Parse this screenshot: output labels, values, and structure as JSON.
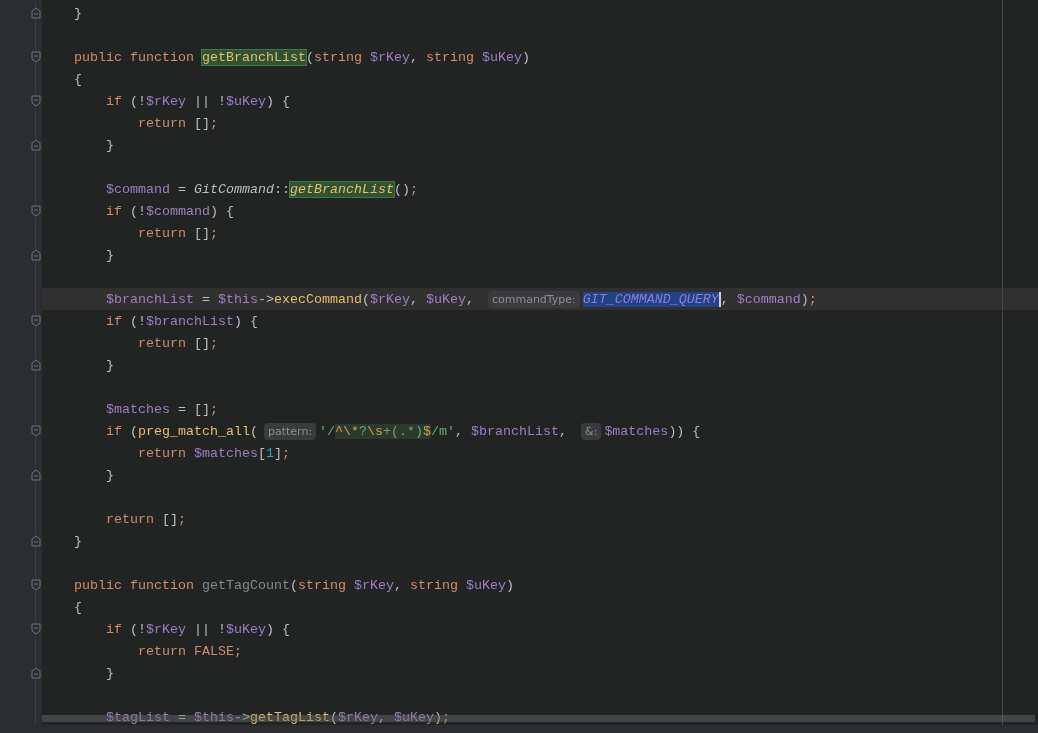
{
  "editor": {
    "lines": [
      {
        "current": false,
        "gutter_mark": {
          "kind": "fold-end"
        },
        "tokens": [
          {
            "text": "    }",
            "kind": "plain"
          }
        ]
      },
      {
        "current": false
      },
      {
        "current": false,
        "gutter_mark": {
          "kind": "fold-start"
        },
        "tokens": [
          {
            "text": "    public function ",
            "kind": "kw"
          },
          {
            "text": "getBranchList",
            "kind": "fn-match"
          },
          {
            "text": "(",
            "kind": "plain"
          },
          {
            "text": "string ",
            "kind": "kw"
          },
          {
            "text": "$rKey",
            "kind": "var"
          },
          {
            "text": ", ",
            "kind": "plain"
          },
          {
            "text": "string ",
            "kind": "kw"
          },
          {
            "text": "$uKey",
            "kind": "var"
          },
          {
            "text": ")",
            "kind": "plain"
          }
        ]
      },
      {
        "current": false,
        "tokens": [
          {
            "text": "    {",
            "kind": "plain"
          }
        ]
      },
      {
        "current": false,
        "gutter_mark": {
          "kind": "fold-start"
        },
        "tokens": [
          {
            "text": "        if ",
            "kind": "kw"
          },
          {
            "text": "(!",
            "kind": "plain"
          },
          {
            "text": "$rKey",
            "kind": "var"
          },
          {
            "text": " || !",
            "kind": "plain"
          },
          {
            "text": "$uKey",
            "kind": "var"
          },
          {
            "text": ") {",
            "kind": "plain"
          }
        ]
      },
      {
        "current": false,
        "tokens": [
          {
            "text": "            return ",
            "kind": "kw"
          },
          {
            "text": "[]",
            "kind": "plain"
          },
          {
            "text": ";",
            "kind": "kw"
          }
        ]
      },
      {
        "current": false,
        "gutter_mark": {
          "kind": "fold-end"
        },
        "tokens": [
          {
            "text": "        }",
            "kind": "plain"
          }
        ]
      },
      {
        "current": false
      },
      {
        "current": false,
        "tokens": [
          {
            "text": "        $command",
            "kind": "var"
          },
          {
            "text": " = ",
            "kind": "plain"
          },
          {
            "text": "GitCommand",
            "kind": "cls"
          },
          {
            "text": "::",
            "kind": "plain"
          },
          {
            "text": "getBranchList",
            "kind": "static-match"
          },
          {
            "text": "()",
            "kind": "plain"
          },
          {
            "text": ";",
            "kind": "kw"
          }
        ]
      },
      {
        "current": false,
        "gutter_mark": {
          "kind": "fold-start"
        },
        "tokens": [
          {
            "text": "        if ",
            "kind": "kw"
          },
          {
            "text": "(!",
            "kind": "plain"
          },
          {
            "text": "$command",
            "kind": "var"
          },
          {
            "text": ") {",
            "kind": "plain"
          }
        ]
      },
      {
        "current": false,
        "tokens": [
          {
            "text": "            return ",
            "kind": "kw"
          },
          {
            "text": "[]",
            "kind": "plain"
          },
          {
            "text": ";",
            "kind": "kw"
          }
        ]
      },
      {
        "current": false,
        "gutter_mark": {
          "kind": "fold-end"
        },
        "tokens": [
          {
            "text": "        }",
            "kind": "plain"
          }
        ]
      },
      {
        "current": false
      },
      {
        "current": true,
        "tokens": [
          {
            "text": "        $branchList",
            "kind": "var"
          },
          {
            "text": " = ",
            "kind": "plain"
          },
          {
            "text": "$this",
            "kind": "var"
          },
          {
            "text": "->",
            "kind": "plain"
          },
          {
            "text": "execCommand",
            "kind": "fn"
          },
          {
            "text": "(",
            "kind": "plain"
          },
          {
            "text": "$rKey",
            "kind": "var"
          },
          {
            "text": ", ",
            "kind": "plain"
          },
          {
            "text": "$uKey",
            "kind": "var"
          },
          {
            "text": ", ",
            "kind": "plain"
          },
          {
            "text": "commandType:",
            "kind": "hint"
          },
          {
            "text": "GIT_COMMAND_QUERY",
            "kind": "selection",
            "caret": true
          },
          {
            "text": ", ",
            "kind": "plain"
          },
          {
            "text": "$command",
            "kind": "var"
          },
          {
            "text": ")",
            "kind": "plain"
          },
          {
            "text": ";",
            "kind": "kw"
          }
        ]
      },
      {
        "current": false,
        "gutter_mark": {
          "kind": "fold-start"
        },
        "tokens": [
          {
            "text": "        if ",
            "kind": "kw"
          },
          {
            "text": "(!",
            "kind": "plain"
          },
          {
            "text": "$branchList",
            "kind": "var"
          },
          {
            "text": ") {",
            "kind": "plain"
          }
        ]
      },
      {
        "current": false,
        "tokens": [
          {
            "text": "            return ",
            "kind": "kw"
          },
          {
            "text": "[]",
            "kind": "plain"
          },
          {
            "text": ";",
            "kind": "kw"
          }
        ]
      },
      {
        "current": false,
        "gutter_mark": {
          "kind": "fold-end"
        },
        "tokens": [
          {
            "text": "        }",
            "kind": "plain"
          }
        ]
      },
      {
        "current": false
      },
      {
        "current": false,
        "tokens": [
          {
            "text": "        $matches",
            "kind": "var"
          },
          {
            "text": " = []",
            "kind": "plain"
          },
          {
            "text": ";",
            "kind": "kw"
          }
        ]
      },
      {
        "current": false,
        "gutter_mark": {
          "kind": "fold-start"
        },
        "tokens": [
          {
            "text": "        if ",
            "kind": "kw"
          },
          {
            "text": "(",
            "kind": "plain"
          },
          {
            "text": "preg_match_all",
            "kind": "fn"
          },
          {
            "text": "(",
            "kind": "plain"
          },
          {
            "text": "pattern:",
            "kind": "hint"
          },
          {
            "text": "'/",
            "kind": "str"
          },
          {
            "text": "^\\*",
            "kind": "regex-esc"
          },
          {
            "text": "?",
            "kind": "regex"
          },
          {
            "text": "\\s",
            "kind": "regex-esc"
          },
          {
            "text": "+(.*)",
            "kind": "regex"
          },
          {
            "text": "$",
            "kind": "regex-esc"
          },
          {
            "text": "/m'",
            "kind": "str"
          },
          {
            "text": ", ",
            "kind": "plain"
          },
          {
            "text": "$branchList",
            "kind": "var"
          },
          {
            "text": ", ",
            "kind": "plain"
          },
          {
            "text": "&:",
            "kind": "hint"
          },
          {
            "text": "$matches",
            "kind": "var"
          },
          {
            "text": ")) {",
            "kind": "plain"
          }
        ]
      },
      {
        "current": false,
        "tokens": [
          {
            "text": "            return ",
            "kind": "kw"
          },
          {
            "text": "$matches",
            "kind": "var"
          },
          {
            "text": "[",
            "kind": "plain"
          },
          {
            "text": "1",
            "kind": "num"
          },
          {
            "text": "]",
            "kind": "plain"
          },
          {
            "text": ";",
            "kind": "kw"
          }
        ]
      },
      {
        "current": false,
        "gutter_mark": {
          "kind": "fold-end"
        },
        "tokens": [
          {
            "text": "        }",
            "kind": "plain"
          }
        ]
      },
      {
        "current": false
      },
      {
        "current": false,
        "tokens": [
          {
            "text": "        return ",
            "kind": "kw"
          },
          {
            "text": "[]",
            "kind": "plain"
          },
          {
            "text": ";",
            "kind": "kw"
          }
        ]
      },
      {
        "current": false,
        "gutter_mark": {
          "kind": "fold-end"
        },
        "tokens": [
          {
            "text": "    }",
            "kind": "plain"
          }
        ]
      },
      {
        "current": false
      },
      {
        "current": false,
        "gutter_mark": {
          "kind": "fold-start"
        },
        "tokens": [
          {
            "text": "    public function ",
            "kind": "kw"
          },
          {
            "text": "getTagCount",
            "kind": "unused"
          },
          {
            "text": "(",
            "kind": "plain"
          },
          {
            "text": "string ",
            "kind": "kw"
          },
          {
            "text": "$rKey",
            "kind": "var"
          },
          {
            "text": ", ",
            "kind": "plain"
          },
          {
            "text": "string ",
            "kind": "kw"
          },
          {
            "text": "$uKey",
            "kind": "var"
          },
          {
            "text": ")",
            "kind": "plain"
          }
        ]
      },
      {
        "current": false,
        "tokens": [
          {
            "text": "    {",
            "kind": "plain"
          }
        ]
      },
      {
        "current": false,
        "gutter_mark": {
          "kind": "fold-start"
        },
        "tokens": [
          {
            "text": "        if ",
            "kind": "kw"
          },
          {
            "text": "(!",
            "kind": "plain"
          },
          {
            "text": "$rKey",
            "kind": "var"
          },
          {
            "text": " || !",
            "kind": "plain"
          },
          {
            "text": "$uKey",
            "kind": "var"
          },
          {
            "text": ") {",
            "kind": "plain"
          }
        ]
      },
      {
        "current": false,
        "tokens": [
          {
            "text": "            return FALSE",
            "kind": "kw"
          },
          {
            "text": ";",
            "kind": "kw"
          }
        ]
      },
      {
        "current": false,
        "gutter_mark": {
          "kind": "fold-end"
        },
        "tokens": [
          {
            "text": "        }",
            "kind": "plain"
          }
        ]
      },
      {
        "current": false
      },
      {
        "current": false,
        "tokens": [
          {
            "text": "        $tagList",
            "kind": "var"
          },
          {
            "text": " = ",
            "kind": "plain"
          },
          {
            "text": "$this",
            "kind": "var"
          },
          {
            "text": "->",
            "kind": "plain"
          },
          {
            "text": "getTagList",
            "kind": "fn"
          },
          {
            "text": "(",
            "kind": "plain"
          },
          {
            "text": "$rKey",
            "kind": "var"
          },
          {
            "text": ", ",
            "kind": "plain"
          },
          {
            "text": "$uKey",
            "kind": "var"
          },
          {
            "text": ")",
            "kind": "plain"
          },
          {
            "text": ";",
            "kind": "kw"
          }
        ]
      }
    ]
  }
}
